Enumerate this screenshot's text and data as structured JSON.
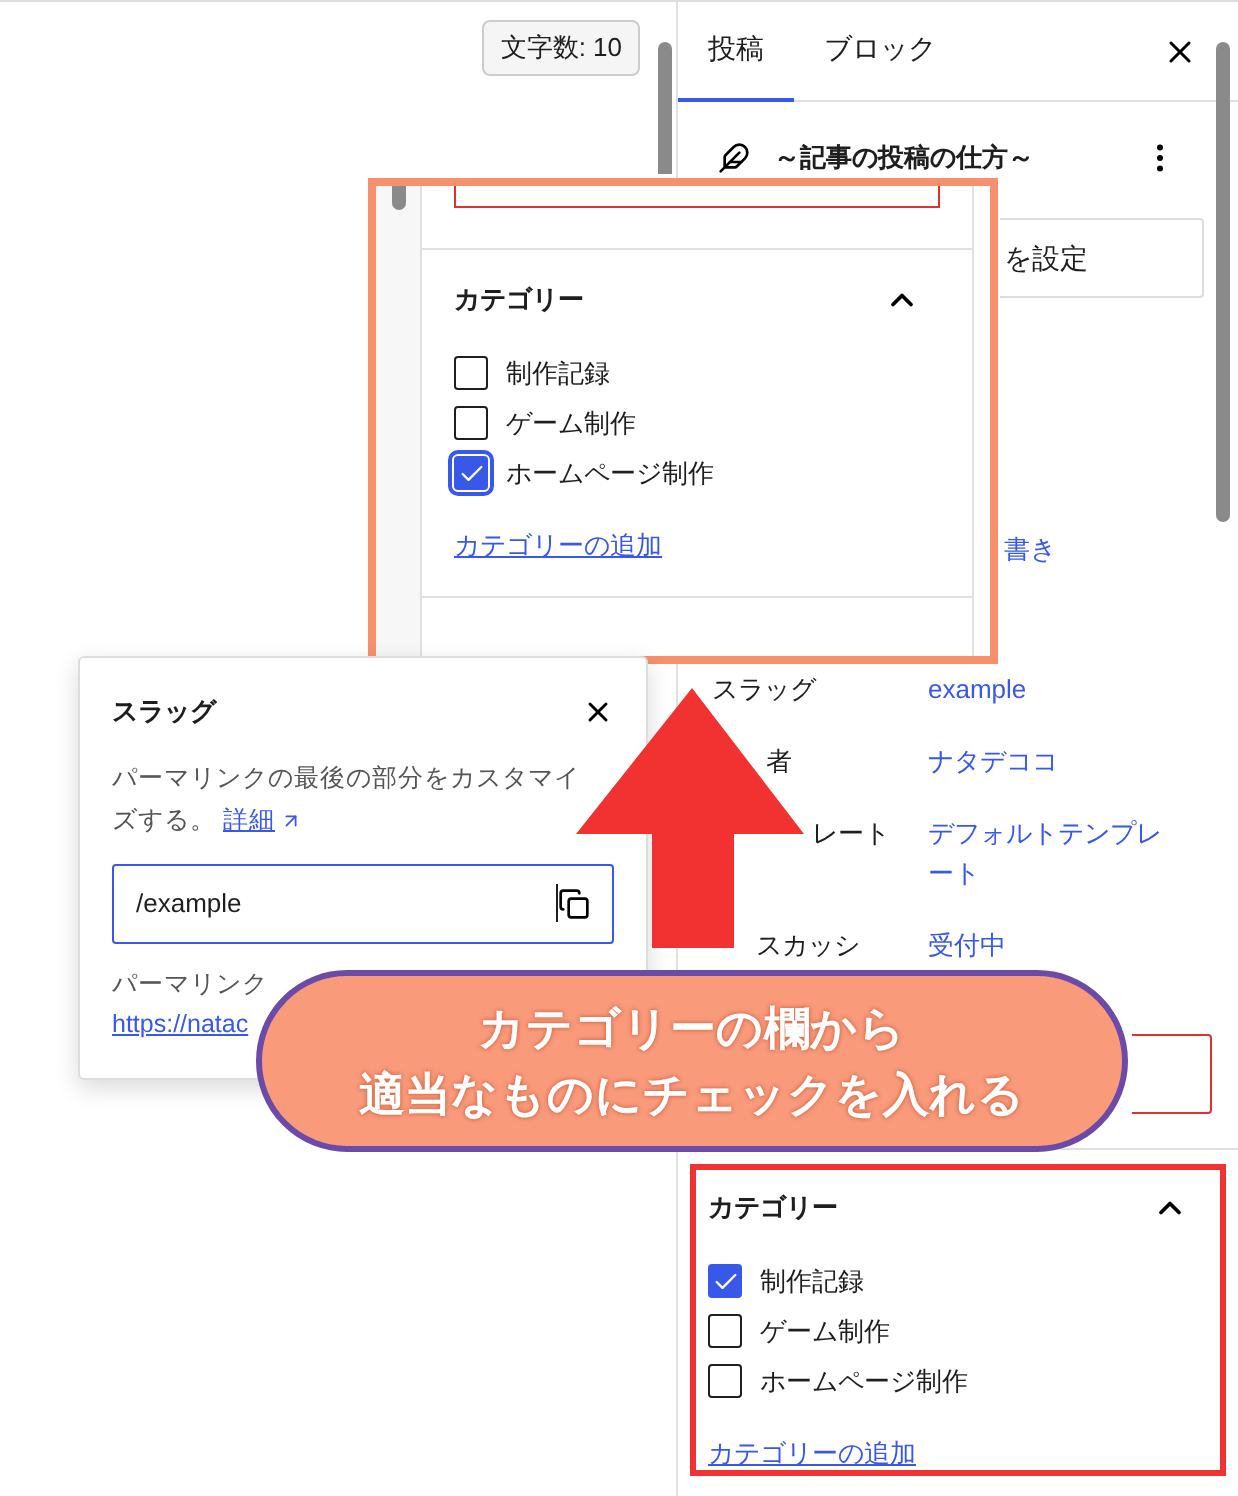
{
  "editor": {
    "word_count": "文字数: 10"
  },
  "sidebar": {
    "tabs": [
      {
        "label": "投稿",
        "selected": true
      },
      {
        "label": "ブロック",
        "selected": false
      }
    ],
    "post_title": "～記事の投稿の仕方～",
    "featured_button": "を設定",
    "status_value": "書き",
    "meta_rows": [
      {
        "label": "スラッグ",
        "value": "example"
      },
      {
        "label": "者",
        "value": "ナタデココ"
      },
      {
        "label": "レート",
        "value": "デフォルトテンプレート"
      },
      {
        "label": "スカッシ",
        "value": "受付中"
      }
    ],
    "categories": {
      "title": "カテゴリー",
      "expanded": true,
      "items": [
        {
          "label": "制作記録",
          "checked": true
        },
        {
          "label": "ゲーム制作",
          "checked": false
        },
        {
          "label": "ホームページ制作",
          "checked": false
        }
      ],
      "add_link": "カテゴリーの追加"
    }
  },
  "zoom_inset": {
    "title": "カテゴリー",
    "expanded": true,
    "items": [
      {
        "label": "制作記録",
        "checked": false
      },
      {
        "label": "ゲーム制作",
        "checked": false
      },
      {
        "label": "ホームページ制作",
        "checked": true
      }
    ],
    "add_link": "カテゴリーの追加"
  },
  "slug_popover": {
    "title": "スラッグ",
    "description": "パーマリンクの最後の部分をカスタマイズする。",
    "learn_more": "詳細",
    "value": "/example",
    "permalink_label": "パーマリンク",
    "permalink_url": "https://natac"
  },
  "callout": {
    "lines": [
      "カテゴリーの欄から",
      "適当なものにチェックを入れる"
    ]
  }
}
